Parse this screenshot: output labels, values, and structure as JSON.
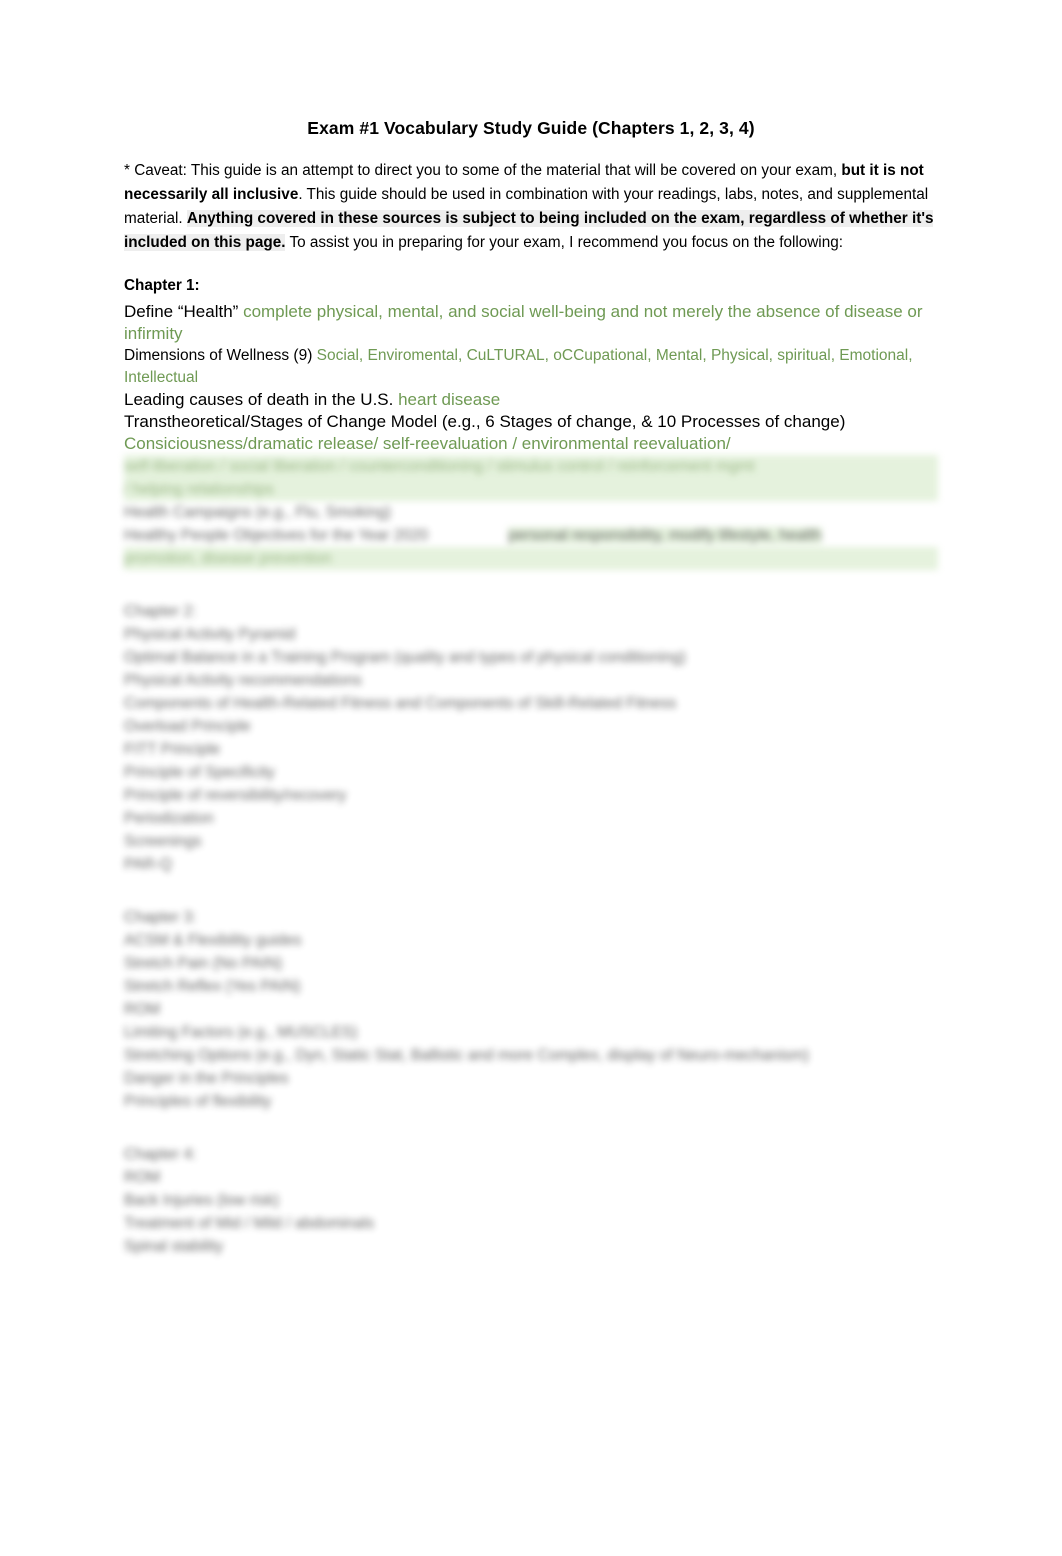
{
  "document": {
    "title": "Exam #1 Vocabulary Study Guide (Chapters 1, 2, 3, 4)",
    "caveat": {
      "part1": "* Caveat:  This guide is an attempt to direct you to some of the material that will be covered on your exam, ",
      "bold1": "but it is not necessarily all inclusive",
      "part2": ".  This guide should be used in combination with your readings, labs, notes, and supplemental material.  ",
      "bold2": "Anything covered in these sources is subject to being included on the exam, regardless of whether it's included on this page.",
      "part3": "  To assist you in preparing for your exam, I recommend you focus on the following:"
    },
    "chapters": [
      {
        "heading": "Chapter 1:",
        "items": [
          {
            "prompt": "Define “Health” ",
            "answer": "complete physical, mental, and social well-being and not merely the absence of disease or infirmity",
            "size": "normal"
          },
          {
            "prompt": "Dimensions of Wellness (9) ",
            "answer": "Social, Enviromental, CuLTURAL, oCCupational, Mental, Physical, spiritual, Emotional, Intellectual",
            "size": "small"
          },
          {
            "prompt": "Leading causes of death in the U.S. ",
            "answer": "heart disease",
            "size": "normal"
          },
          {
            "prompt": "Transtheoretical/Stages of Change Model (e.g., 6 Stages of change, & 10 Processes of change) ",
            "answer": "Consiciousness/dramatic release/ self-reevaluation / environmental reevaluation/",
            "size": "normal"
          }
        ],
        "blurred_lines": [
          {
            "text": "self-liberation / social liberation / counterconditioning / stimulus control / reinforcement mgmt",
            "green": true
          },
          {
            "text": "/ helping relationships",
            "green": true
          },
          {
            "text": "Health Campaigns (e.g., Flu, Smoking)",
            "green": false
          },
          {
            "text": "Healthy People Objectives for the Year 2020",
            "green": false
          },
          {
            "text": "personal responsibility, modify lifestyle, health",
            "green": true
          },
          {
            "text": "promotion, disease prevention",
            "green": true
          }
        ]
      },
      {
        "heading": "Chapter 2:",
        "blurred_lines": [
          {
            "text": "Physical Activity Pyramid",
            "green": false
          },
          {
            "text": "Optimal Balance in a Training Program (quality and types of physical conditioning)",
            "green": false
          },
          {
            "text": "Physical Activity recommendations",
            "green": false
          },
          {
            "text": "Components of Health-Related Fitness and Components of Skill-Related Fitness",
            "green": false
          },
          {
            "text": "Overload Principle",
            "green": false
          },
          {
            "text": "FITT Principle",
            "green": false
          },
          {
            "text": "Principle of Specificity",
            "green": false
          },
          {
            "text": "Principle of reversibility/recovery",
            "green": false
          },
          {
            "text": "Periodization",
            "green": false
          },
          {
            "text": "Screenings",
            "green": false
          },
          {
            "text": "PAR-Q",
            "green": false
          }
        ]
      },
      {
        "heading": "Chapter 3:",
        "blurred_lines": [
          {
            "text": "ACSM & Flexibility guides",
            "green": false
          },
          {
            "text": "Stretch Pain (No PAIN)",
            "green": false
          },
          {
            "text": "Stretch Reflex (Yes PAIN)",
            "green": false
          },
          {
            "text": "ROM",
            "green": false
          },
          {
            "text": "Limiting Factors (e.g., MUSCLES)",
            "green": false
          },
          {
            "text": "Stretching Options (e.g., Dyn, Static Stat, Ballistic and more Complex, display of Neuro-mechanism)",
            "green": false
          },
          {
            "text": "Danger in the Principles",
            "green": false
          },
          {
            "text": "Principles of flexibility",
            "green": false
          }
        ]
      },
      {
        "heading": "Chapter 4:",
        "blurred_lines": [
          {
            "text": "ROM",
            "green": false
          },
          {
            "text": "Back Injuries (low risk)",
            "green": false
          },
          {
            "text": "Treatment of Mid / Mild / abdominals",
            "green": false
          },
          {
            "text": "Spinal stability",
            "green": false
          }
        ]
      }
    ]
  }
}
